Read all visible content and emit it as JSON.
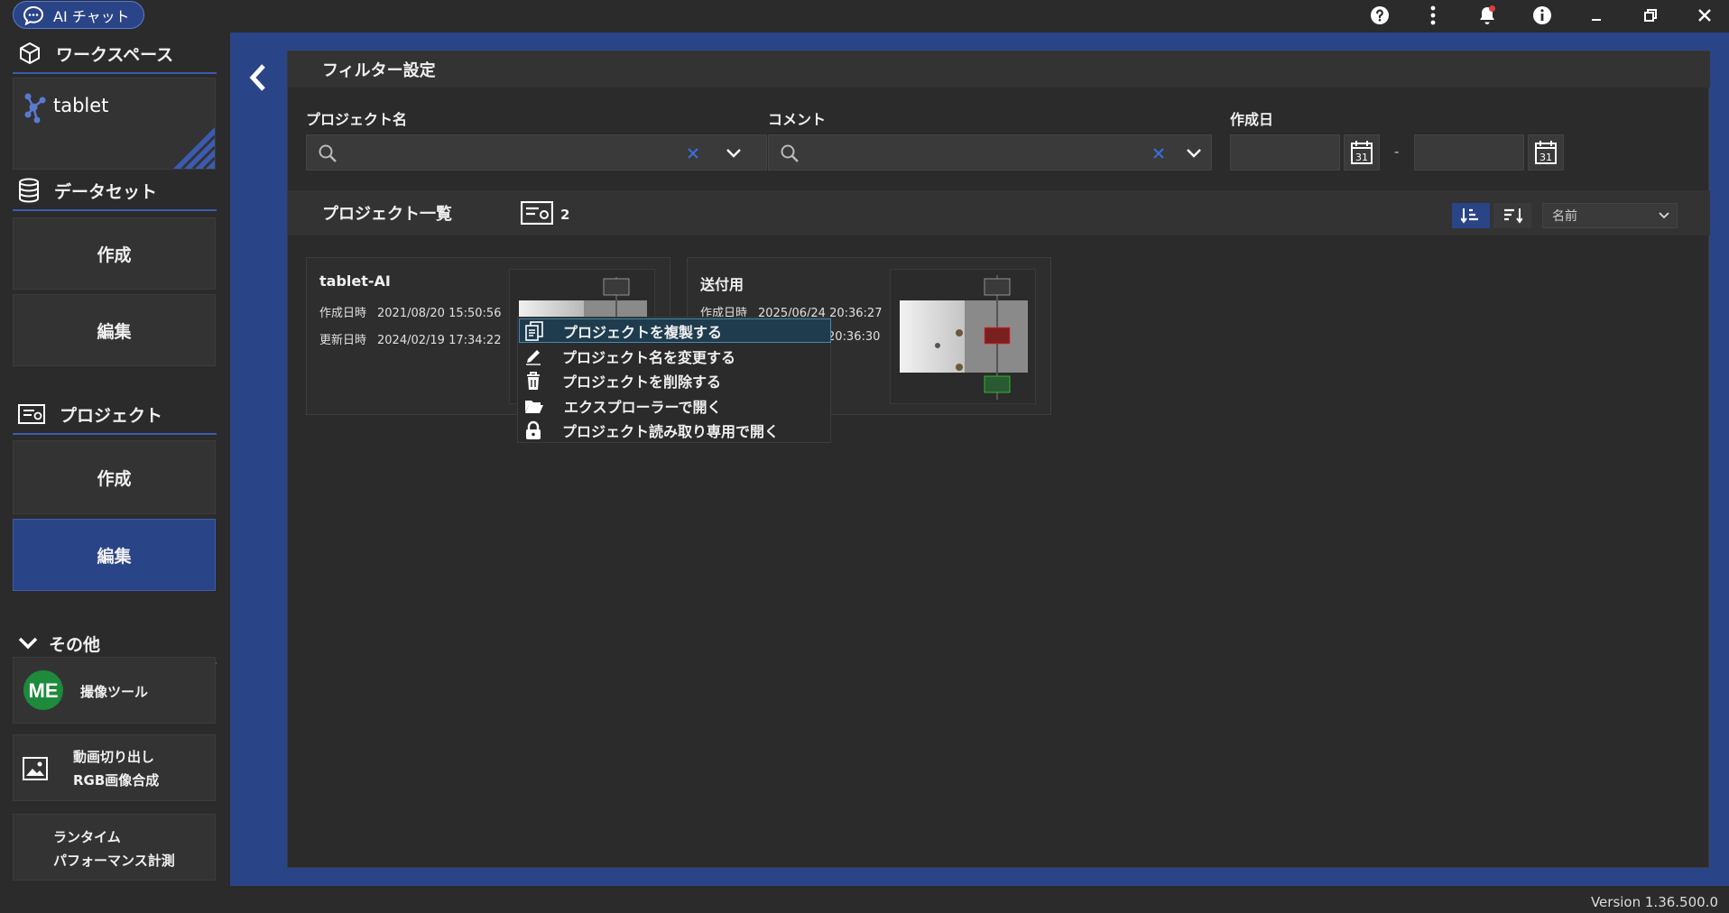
{
  "titlebar": {
    "chat_label": "AI チャット",
    "icons": [
      "help-icon",
      "more-vert-icon",
      "notification-bell-icon",
      "info-icon",
      "minimize-icon",
      "restore-icon",
      "close-icon"
    ]
  },
  "sidebar": {
    "workspace": {
      "heading": "ワークスペース",
      "name": "tablet"
    },
    "dataset": {
      "heading": "データセット",
      "create": "作成",
      "edit": "編集"
    },
    "project": {
      "heading": "プロジェクト",
      "create": "作成",
      "edit": "編集"
    },
    "other": {
      "heading": "その他",
      "me_logo": "ME",
      "capture_tool": "撮像ツール",
      "video_line1": "動画切り出し",
      "video_line2": "RGB画像合成",
      "runtime_line1": "ランタイム",
      "runtime_line2": "パフォーマンス計測"
    }
  },
  "filter": {
    "heading": "フィルター設定",
    "project_name_label": "プロジェクト名",
    "comment_label": "コメント",
    "date_label": "作成日",
    "date_separator": "-",
    "calendar_day": "31"
  },
  "list": {
    "heading": "プロジェクト一覧",
    "count": "2",
    "sort_select": "名前",
    "cards": [
      {
        "title": "tablet-AI",
        "created_label": "作成日時",
        "created": "2021/08/20 15:50:56",
        "updated_label": "更新日時",
        "updated": "2024/02/19 17:34:22"
      },
      {
        "title": "送付用",
        "created_label": "作成日時",
        "created": "2025/06/24 20:36:27",
        "updated_suffix": "20:36:30"
      }
    ]
  },
  "context_menu": {
    "items": [
      {
        "label": "プロジェクトを複製する",
        "icon": "duplicate-icon"
      },
      {
        "label": "プロジェクト名を変更する",
        "icon": "pencil-icon"
      },
      {
        "label": "プロジェクトを削除する",
        "icon": "trash-icon"
      },
      {
        "label": "エクスプローラーで開く",
        "icon": "folder-open-icon"
      },
      {
        "label": "プロジェクト読み取り専用で開く",
        "icon": "lock-icon"
      }
    ]
  },
  "footer": {
    "version": "Version 1.36.500.0"
  },
  "colors": {
    "accent": "#2a4488",
    "background": "#2b2b2b",
    "panel": "#333333",
    "highlight": "#1e3c4e"
  }
}
